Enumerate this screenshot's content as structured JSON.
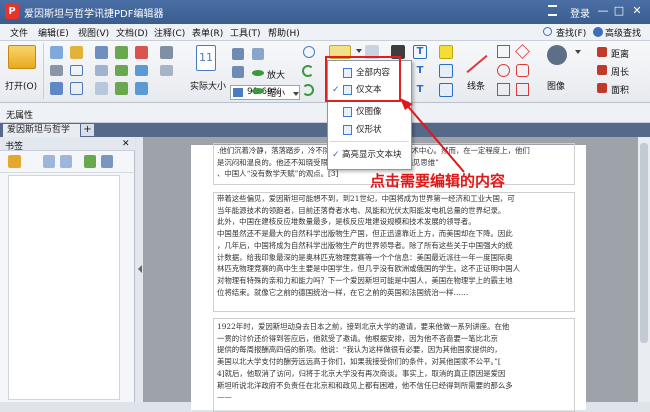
{
  "app": {
    "logo": "P",
    "title": "爱因斯坦与哲学讯捷PDF编辑器",
    "login": "登录",
    "minimize": "—",
    "maximize": "□",
    "close": "✕"
  },
  "menu": [
    "文件",
    "编辑(E)",
    "视图(V)",
    "文档(D)",
    "注释(C)",
    "表单(R)",
    "工具(T)",
    "帮助(H)"
  ],
  "ribbon": {
    "open_label": "打开(O)",
    "zoom_value": "91.69%",
    "actual_size_label": "实际大小",
    "actual_size_number": "11",
    "zoom_in_label": "放大",
    "zoom_out_label": "缩小",
    "shapes_label": "线条",
    "image_label": "图像",
    "distance_label": "距离",
    "perimeter_label": "周长",
    "area_label": "面积",
    "find_label": "查找(F)",
    "advanced_find_label": "高级查找"
  },
  "propbar": {
    "label": "无属性"
  },
  "tabs": {
    "active": "爱因斯坦与哲学",
    "add": "+"
  },
  "leftpanel": {
    "title": "书签",
    "close": "✕"
  },
  "dropdown": {
    "items": [
      "全部内容",
      "仅文本",
      "仅图像",
      "仅形状",
      "高亮显示文本块"
    ],
    "checked": "仅文本"
  },
  "annotation": "点击需要编辑的内容",
  "document": {
    "para1": ".他们沉着冷静，落落踏步，冷不防来到世上成了当时世界学术中心。然而，在一定程度上，他们\n是沉闷和温良的。他还不知晓受限于当时中国人“不能改变偏见思维”\n、中国人“没有数学天赋”的观点。[3]",
    "para2": "带着这些偏见，爱因斯坦可能想不到，到21世纪，中国将成为世界第一经济和工业大国，可\n当年能源技术的领跑者，目前还落脊者水电、风能和光伏太阳能发电机总量的世界纪录。\n此外，中国在建核反应堆数量最多，是核反应堆建设规模和技术发展的领导者。\n中国虽然还不是最大的自然科学出版物生产国，但正迅速靠近上方，而美国却在下降。因此\n，几年后，中国将成为自然科学出版物生产的世界领导者。除了所有这些关于中国强大的统\n计数据，给我印象最深的是奥林匹克物理竞赛等一个个信息：美国最近派往一年一度国际奥\n林匹克物理竞赛的高中生主要是中国学生，但几乎没有欧洲或俄国的学生。这不正证明中国人\n对物理有特殊的亲和力和能力吗？下一个爱因斯坦可能是中国人，美国在物理学上的霸主地\n位将结束。就像它之前的德国统治一样，在它之前的英国和法国统治一样……",
    "para3": "1922年时，爱因斯坦动身去日本之前，接到北京大学的邀请，要来他做一系列讲座。在他\n一贯的讨价还价得到答应后，他就受了邀请。他根据安排，因为他不吝啬要一笔比北京\n提供的每周报酬高四倍的新项。他说：“我认为这样做很有必要，因为其他国家提供的，\n美国以北大学支付的酬劳远远高于你们，如果我接受你们的条件，对其他国家不公平。”[\n4]就后，他取消了访问，归将于北京大学没有再次商谈。事实上，取消的真正原因是爱因\n斯坦听说北洋政府不负责任在北京和和政见上都有困难，他不信任已经得到所需要的那么多\n——"
  },
  "colors": {
    "accent": "#3a5d8f",
    "highlight_red": "#e02020",
    "annotation_red": "#e01818"
  }
}
